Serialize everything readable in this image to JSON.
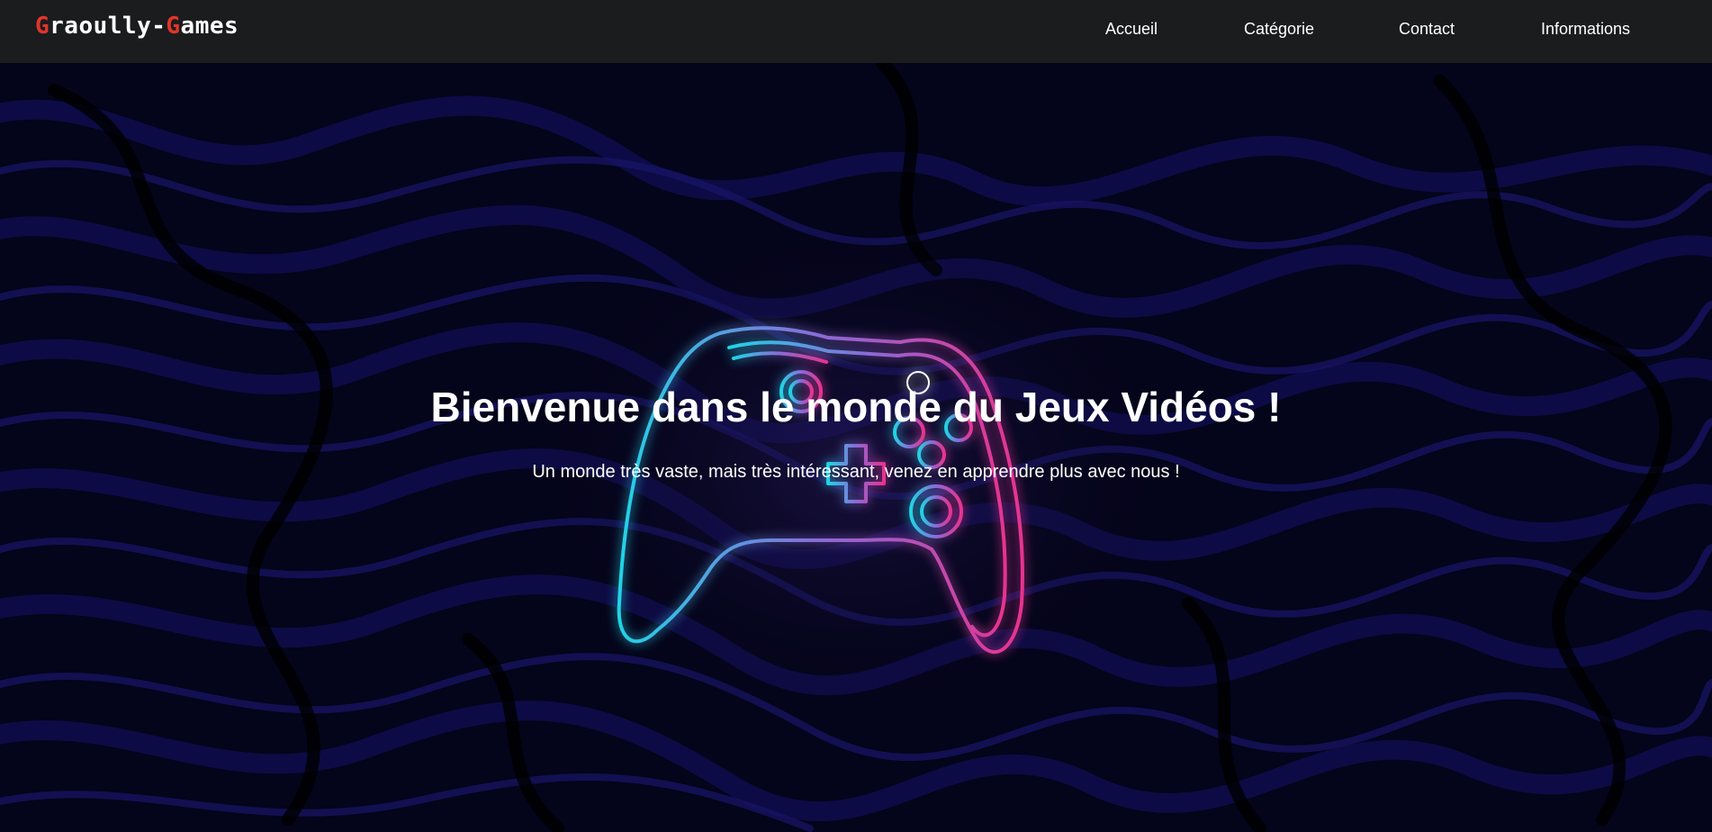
{
  "brand": {
    "logo_first_initial": "G",
    "logo_middle": "raoully-",
    "logo_second_initial": "G",
    "logo_end": "ames",
    "accent_color": "#e2352a"
  },
  "nav": {
    "items": [
      {
        "label": "Accueil"
      },
      {
        "label": "Catégorie"
      },
      {
        "label": "Contact"
      },
      {
        "label": "Informations"
      }
    ]
  },
  "hero": {
    "title": "Bienvenue dans le monde du Jeux Vidéos !",
    "subtitle": "Un monde très vaste, mais très intéressant, venez en apprendre plus avec nous !",
    "image_icon": "gamepad-icon",
    "glow_colors": [
      "#22d3e6",
      "#e8338f"
    ]
  }
}
